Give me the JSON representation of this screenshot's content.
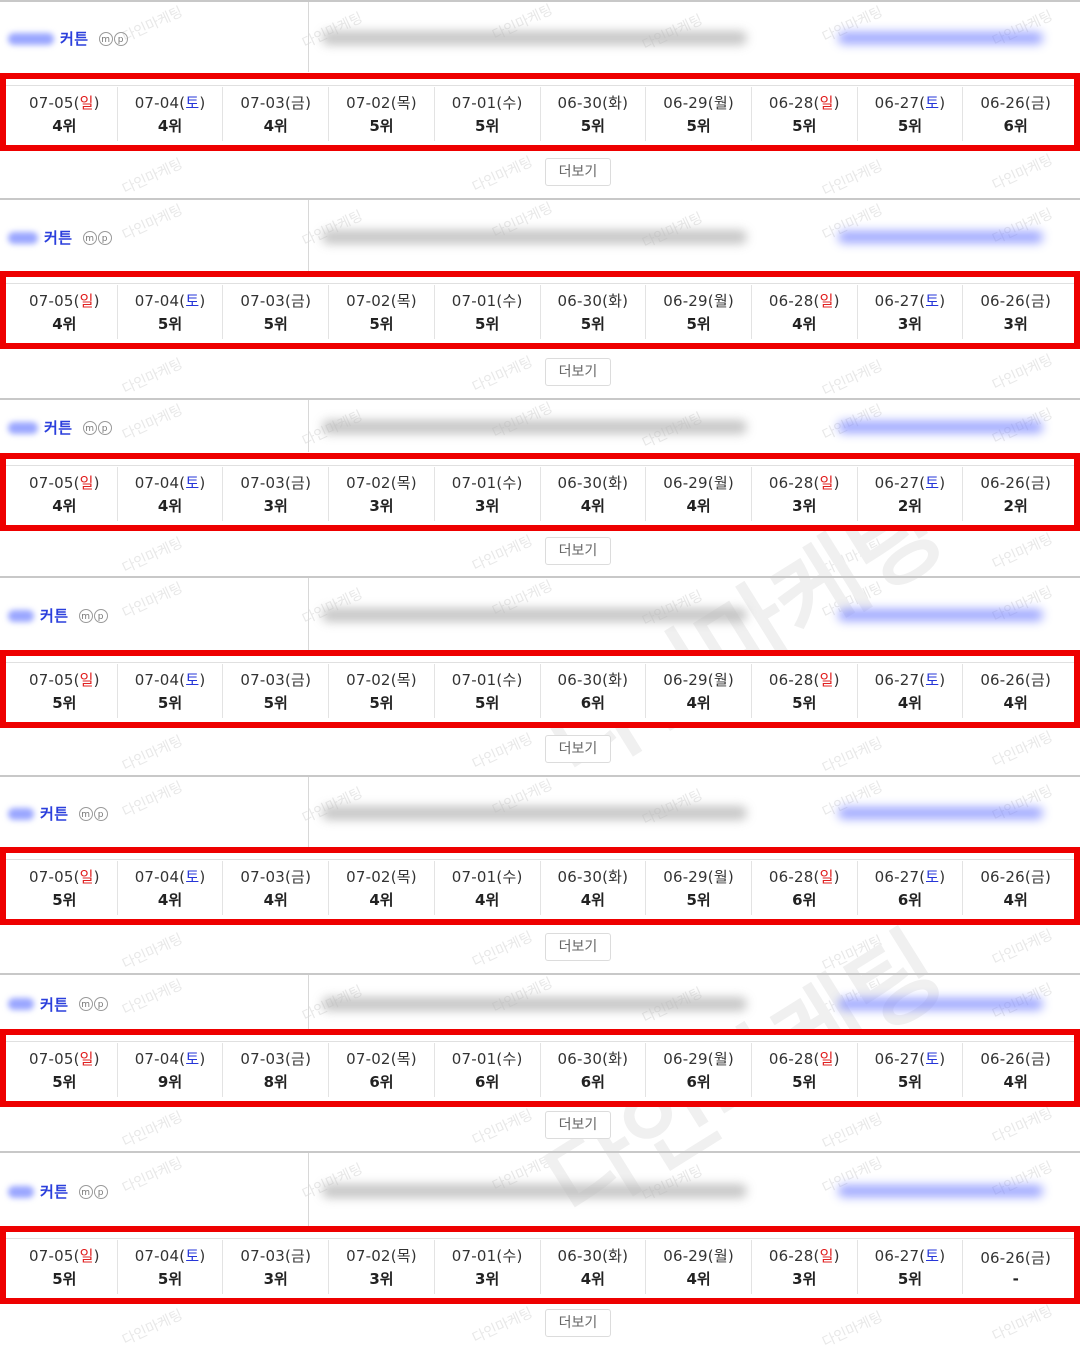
{
  "keyword": "커튼",
  "badge_m": "m",
  "badge_p": "p",
  "more_label": "더보기",
  "watermark": "다인마케팅",
  "colors": {
    "sunday": "#e02020",
    "saturday": "#2636d8",
    "highlight": "#ee0000"
  },
  "dates": [
    {
      "md": "07-05",
      "dow": "일",
      "type": "sun"
    },
    {
      "md": "07-04",
      "dow": "토",
      "type": "sat"
    },
    {
      "md": "07-03",
      "dow": "금",
      "type": "wk"
    },
    {
      "md": "07-02",
      "dow": "목",
      "type": "wk"
    },
    {
      "md": "07-01",
      "dow": "수",
      "type": "wk"
    },
    {
      "md": "06-30",
      "dow": "화",
      "type": "wk"
    },
    {
      "md": "06-29",
      "dow": "월",
      "type": "wk"
    },
    {
      "md": "06-28",
      "dow": "일",
      "type": "sun"
    },
    {
      "md": "06-27",
      "dow": "토",
      "type": "sat"
    },
    {
      "md": "06-26",
      "dow": "금",
      "type": "wk"
    }
  ],
  "rows": [
    {
      "ranks": [
        "4위",
        "4위",
        "4위",
        "5위",
        "5위",
        "5위",
        "5위",
        "5위",
        "5위",
        "6위"
      ]
    },
    {
      "ranks": [
        "4위",
        "5위",
        "5위",
        "5위",
        "5위",
        "5위",
        "5위",
        "4위",
        "3위",
        "3위"
      ]
    },
    {
      "ranks": [
        "4위",
        "4위",
        "3위",
        "3위",
        "3위",
        "4위",
        "4위",
        "3위",
        "2위",
        "2위"
      ]
    },
    {
      "ranks": [
        "5위",
        "5위",
        "5위",
        "5위",
        "5위",
        "6위",
        "4위",
        "5위",
        "4위",
        "4위"
      ]
    },
    {
      "ranks": [
        "5위",
        "4위",
        "4위",
        "4위",
        "4위",
        "4위",
        "5위",
        "6위",
        "6위",
        "4위"
      ]
    },
    {
      "ranks": [
        "5위",
        "9위",
        "8위",
        "6위",
        "6위",
        "6위",
        "6위",
        "5위",
        "5위",
        "4위"
      ]
    },
    {
      "ranks": [
        "5위",
        "5위",
        "3위",
        "3위",
        "3위",
        "4위",
        "4위",
        "3위",
        "5위",
        "-"
      ]
    }
  ]
}
